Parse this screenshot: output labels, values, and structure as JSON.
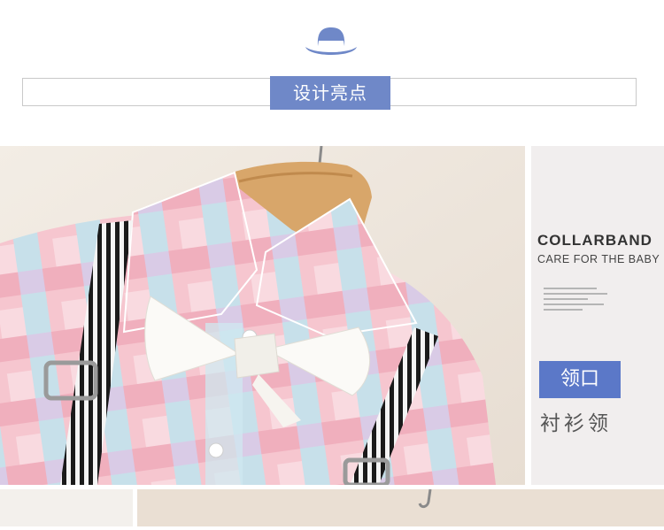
{
  "header": {
    "section_title": "设计亮点",
    "icon": "hat-icon"
  },
  "feature": {
    "title_en": "COLLARBAND",
    "subtitle_en": "CARE FOR THE BABY",
    "badge": "领口",
    "caption": "衬衫领"
  },
  "colors": {
    "accent": "#6f88c8",
    "badge": "#5b78c8"
  }
}
